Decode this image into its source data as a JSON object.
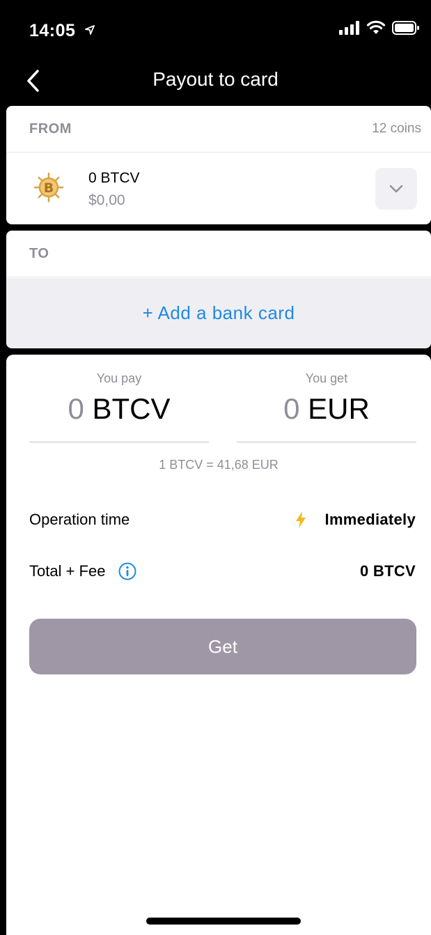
{
  "status_bar": {
    "time": "14:05"
  },
  "nav": {
    "title": "Payout to card"
  },
  "from": {
    "label": "FROM",
    "coins_count": "12 coins",
    "coin_amount": "0 BTCV",
    "coin_fiat": "$0,00",
    "coin_icon": "bitcoin-vault-icon"
  },
  "to": {
    "label": "TO",
    "add_card": "+ Add a bank card"
  },
  "exchange": {
    "pay_label": "You pay",
    "pay_amount": "0",
    "pay_currency": "BTCV",
    "get_label": "You get",
    "get_amount": "0",
    "get_currency": "EUR",
    "rate": "1 BTCV = 41,68 EUR"
  },
  "details": {
    "operation_time_label": "Operation time",
    "operation_time_value": "Immediately",
    "total_fee_label": "Total + Fee",
    "total_fee_value": "0 BTCV"
  },
  "actions": {
    "get_label": "Get"
  },
  "colors": {
    "accent": "#2089e6",
    "button_disabled": "#9f97a6",
    "muted_text": "#8e8e98",
    "bolt": "#f5b919",
    "coin_gold": "#d9a441"
  }
}
